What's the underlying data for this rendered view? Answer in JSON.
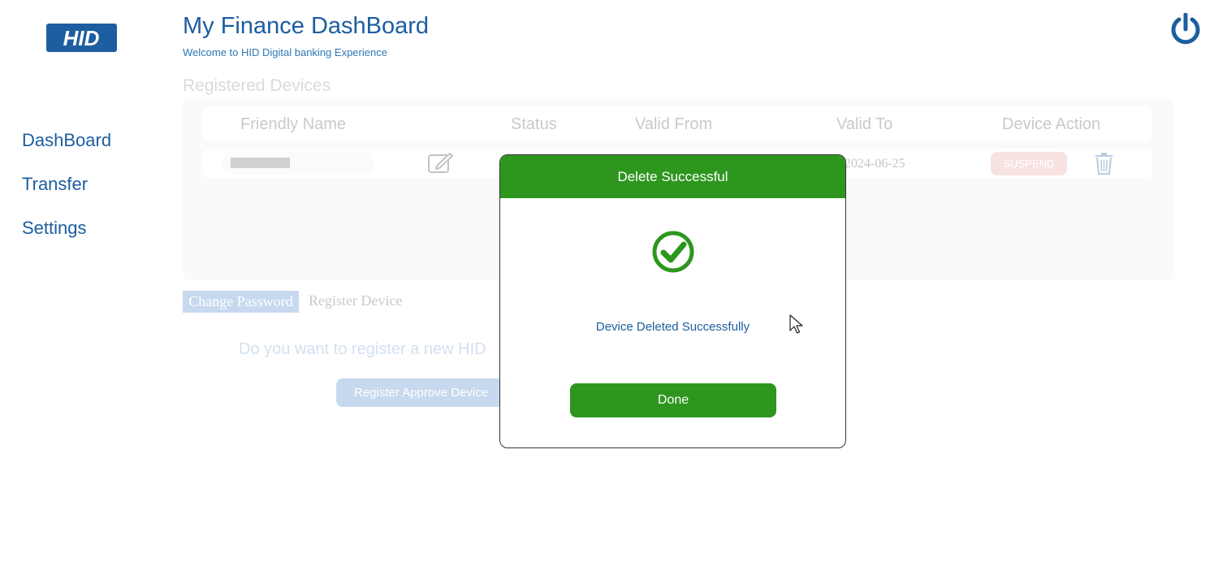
{
  "brand": {
    "logo_text": "HID",
    "color": "#1c5ea0"
  },
  "header": {
    "title": "My Finance DashBoard",
    "subtitle": "Welcome to HID Digital banking Experience",
    "power_icon": "power-icon"
  },
  "sidebar": {
    "items": [
      {
        "label": "DashBoard"
      },
      {
        "label": "Transfer"
      },
      {
        "label": "Settings"
      }
    ]
  },
  "devices": {
    "section_title": "Registered Devices",
    "columns": [
      "Friendly Name",
      "Status",
      "Valid From",
      "Valid To",
      "Device Action"
    ],
    "rows": [
      {
        "valid_to": "2024-06-25",
        "action_label": "SUSPEND"
      }
    ]
  },
  "tabs": {
    "active": "Change Password",
    "other": "Register Device"
  },
  "register": {
    "question": "Do you want to register a new HID",
    "button_label": "Register Approve Device"
  },
  "modal": {
    "title": "Delete Successful",
    "message": "Device Deleted Successfully",
    "done_label": "Done",
    "accent": "#2e961f"
  }
}
